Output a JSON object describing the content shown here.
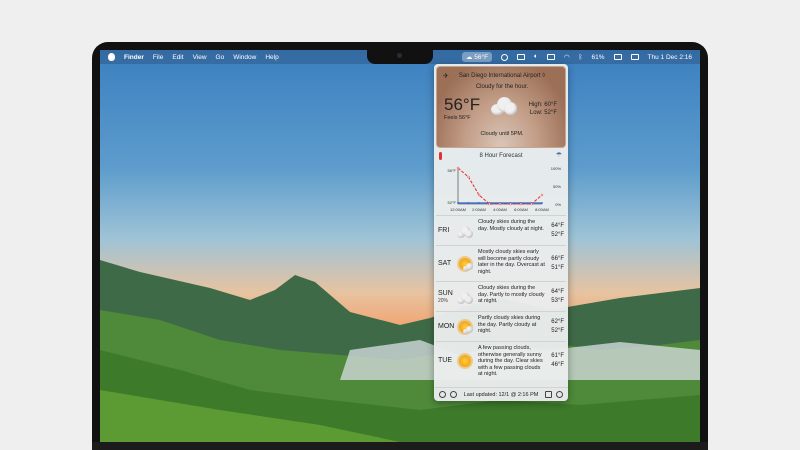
{
  "menubar": {
    "app": "Finder",
    "menus": [
      "File",
      "Edit",
      "View",
      "Go",
      "Window",
      "Help"
    ],
    "weather": "56°F",
    "battery": "61%",
    "datetime": "Thu 1 Dec  2:16"
  },
  "current": {
    "location": "San Diego International Airport ◊",
    "summary": "Cloudy for the hour.",
    "temp": "56°F",
    "feels": "Feels 56°F",
    "high": "High:  60°F",
    "low": "Low:  52°F",
    "until": "Cloudy until 5PM."
  },
  "forecast_title": "8 Hour Forecast",
  "chart_data": {
    "type": "line",
    "x": [
      "12:00AM",
      "",
      "2:00AM",
      "",
      "4:00AM",
      "",
      "6:00AM",
      "",
      "8:00AM"
    ],
    "series": [
      {
        "values": [
          56,
          55,
          53,
          52,
          52,
          52,
          52,
          52,
          53
        ],
        "color": "#e03a3a"
      },
      {
        "values": [
          0,
          0,
          0,
          0,
          0,
          0,
          0,
          0,
          0
        ],
        "color": "#2f5fcf"
      }
    ],
    "y_left_labels": [
      "56°F",
      "52°F"
    ],
    "y_right_labels": [
      "100%",
      "50%",
      "0%"
    ],
    "x_tick_labels": [
      "12:00AM",
      "2:00AM",
      "4:00AM",
      "6:00AM",
      "8:00AM"
    ],
    "ylim": [
      52,
      56
    ]
  },
  "days": [
    {
      "name": "FRI",
      "pct": "",
      "icon": "cloud-icon",
      "desc": "Cloudy skies during the day. Mostly cloudy at night.",
      "hi": "64°F",
      "lo": "52°F"
    },
    {
      "name": "SAT",
      "pct": "",
      "icon": "partly-cloudy-icon",
      "desc": "Mostly cloudy skies early will become partly cloudy later in the day. Overcast at night.",
      "hi": "66°F",
      "lo": "51°F"
    },
    {
      "name": "SUN",
      "pct": "20%",
      "icon": "cloud-icon",
      "desc": "Cloudy skies during the day. Partly to mostly cloudy at night.",
      "hi": "64°F",
      "lo": "53°F"
    },
    {
      "name": "MON",
      "pct": "",
      "icon": "partly-cloudy-icon",
      "desc": "Partly cloudy skies during the day. Partly cloudy at night.",
      "hi": "62°F",
      "lo": "52°F"
    },
    {
      "name": "TUE",
      "pct": "",
      "icon": "sun-icon",
      "desc": "A few passing clouds, otherwise generally sunny during the day. Clear skies with a few passing clouds at night.",
      "hi": "61°F",
      "lo": "46°F"
    }
  ],
  "footer": {
    "updated": "Last updated: 12/1 @ 2:16 PM"
  }
}
